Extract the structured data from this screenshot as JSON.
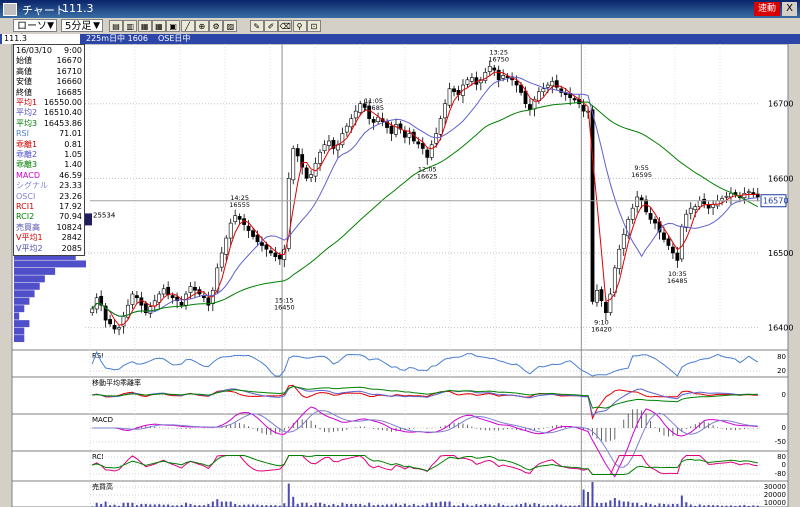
{
  "titlebar": {
    "title": "チャート",
    "code": "111.3",
    "live_label": "速動",
    "close_label": "X"
  },
  "toolbar": {
    "chart_type": "ローソク",
    "interval": "5分足",
    "arrow": "▼",
    "tool_icons": [
      "chart-type-icon",
      "bar-chart-icon",
      "grid-icon",
      "grid2-icon",
      "period-icon",
      "line-tool-icon",
      "zoom-icon",
      "settings-icon",
      "multi-chart-icon",
      "pen-icon",
      "pencil-icon",
      "erase-icon",
      "search-icon",
      "lock-icon"
    ]
  },
  "infobar": {
    "code": "111.3",
    "item1": "225m日中 1606",
    "item2": "OSE日中"
  },
  "panel": {
    "rows": [
      {
        "label": "16/03/10",
        "value": "9:00",
        "color": "#000000"
      },
      {
        "label": "始値",
        "value": "16670",
        "color": "#000000"
      },
      {
        "label": "高値",
        "value": "16710",
        "color": "#000000"
      },
      {
        "label": "安値",
        "value": "16660",
        "color": "#000000"
      },
      {
        "label": "終値",
        "value": "16685",
        "color": "#000000"
      },
      {
        "label": "平均1",
        "value": "16550.00",
        "color": "#d00000"
      },
      {
        "label": "平均2",
        "value": "16510.40",
        "color": "#5050d0"
      },
      {
        "label": "平均3",
        "value": "16453.86",
        "color": "#008000"
      },
      {
        "label": "RSI",
        "value": "71.01",
        "color": "#4a7fd0"
      },
      {
        "label": "乖離1",
        "value": "0.81",
        "color": "#d00000"
      },
      {
        "label": "乖離2",
        "value": "1.05",
        "color": "#5050d0"
      },
      {
        "label": "乖離3",
        "value": "1.40",
        "color": "#008000"
      },
      {
        "label": "MACD",
        "value": "46.59",
        "color": "#d000d0"
      },
      {
        "label": "シグナル",
        "value": "23.33",
        "color": "#8080d0"
      },
      {
        "label": "OSCI",
        "value": "23.26",
        "color": "#8080d0"
      },
      {
        "label": "RCI1",
        "value": "17.92",
        "color": "#d00000"
      },
      {
        "label": "RCI2",
        "value": "70.94",
        "color": "#008000"
      },
      {
        "label": "売買高",
        "value": "10824",
        "color": "#4a4ab0"
      },
      {
        "label": "V平均1",
        "value": "2842",
        "color": "#d00000"
      },
      {
        "label": "V平均2",
        "value": "2085",
        "color": "#4a4ab0"
      }
    ]
  },
  "colors": {
    "up": "#ffffff",
    "down": "#000000",
    "ma1": "#e00000",
    "ma2": "#6060d0",
    "ma3": "#008000",
    "rsi": "#4a7fd0",
    "macd": "#d000d0",
    "signal": "#8080d0",
    "rci1": "#e00080",
    "rci2": "#008000",
    "volume": "#4a4ab0",
    "grid": "#c0c0c0",
    "price_marker": "#1e3ca0",
    "volume_profile": "#3030c0"
  },
  "chart_data": {
    "type": "candlestick",
    "price_axis": {
      "ticks": [
        16400,
        16500,
        16600,
        16700
      ],
      "range": [
        16370,
        16780
      ]
    },
    "current_price": 16570,
    "volume_profile": {
      "price_min": 16380,
      "price_step": 10,
      "levels": [
        2,
        2,
        3,
        1,
        2,
        3,
        4,
        5,
        6,
        8,
        14,
        12,
        10,
        9,
        8,
        10,
        12,
        9,
        7,
        5,
        6,
        5,
        4,
        3,
        3,
        2,
        2,
        1,
        1,
        2,
        2,
        1,
        3,
        3,
        2,
        2,
        1,
        1,
        1,
        1
      ]
    },
    "peak_label": {
      "value": "25534",
      "price": 16545
    },
    "annotations": [
      {
        "time": "14:25",
        "price": 16555,
        "index": 33,
        "pos": "above"
      },
      {
        "time": "15:15",
        "price": 16450,
        "index": 43,
        "pos": "below"
      },
      {
        "time": "11:05",
        "price": 16685,
        "index": 63,
        "pos": "above"
      },
      {
        "time": "12:05",
        "price": 16625,
        "index": 75,
        "pos": "below"
      },
      {
        "time": "13:25",
        "price": 16750,
        "index": 91,
        "pos": "above"
      },
      {
        "time": "9:10",
        "price": 16420,
        "index": 114,
        "pos": "below"
      },
      {
        "time": "9:55",
        "price": 16595,
        "index": 123,
        "pos": "above"
      },
      {
        "time": "10:35",
        "price": 16485,
        "index": 131,
        "pos": "below"
      }
    ],
    "session_breaks": [
      43,
      110
    ],
    "close": [
      16425,
      16440,
      16430,
      16410,
      16405,
      16398,
      16400,
      16415,
      16430,
      16445,
      16440,
      16430,
      16420,
      16428,
      16436,
      16445,
      16452,
      16444,
      16440,
      16436,
      16430,
      16445,
      16455,
      16450,
      16445,
      16440,
      16430,
      16450,
      16480,
      16500,
      16520,
      16540,
      16550,
      16545,
      16538,
      16530,
      16522,
      16515,
      16510,
      16505,
      16500,
      16495,
      16492,
      16505,
      16600,
      16640,
      16630,
      16615,
      16600,
      16605,
      16620,
      16635,
      16645,
      16650,
      16640,
      16645,
      16660,
      16670,
      16680,
      16690,
      16700,
      16695,
      16680,
      16675,
      16682,
      16676,
      16668,
      16660,
      16672,
      16666,
      16655,
      16660,
      16650,
      16646,
      16640,
      16628,
      16645,
      16660,
      16680,
      16700,
      16720,
      16716,
      16712,
      16725,
      16732,
      16735,
      16726,
      16732,
      16742,
      16750,
      16745,
      16732,
      16738,
      16735,
      16732,
      16725,
      16715,
      16700,
      16692,
      16706,
      16716,
      16720,
      16725,
      16730,
      16722,
      16715,
      16712,
      16708,
      16705,
      16700,
      16690,
      16690,
      16435,
      16450,
      16436,
      16420,
      16445,
      16480,
      16505,
      16525,
      16545,
      16560,
      16575,
      16570,
      16555,
      16545,
      16540,
      16528,
      16518,
      16510,
      16500,
      16490,
      16535,
      16552,
      16560,
      16562,
      16570,
      16566,
      16560,
      16565,
      16570,
      16573,
      16576,
      16580,
      16578,
      16574,
      16580,
      16582,
      16578,
      16575
    ]
  },
  "subcharts": [
    {
      "label": "RSI",
      "ticks": [
        "80",
        "20"
      ]
    },
    {
      "label": "移動平均乖離率",
      "ticks": [
        "0"
      ]
    },
    {
      "label": "MACD",
      "ticks": [
        "0",
        "-50"
      ]
    },
    {
      "label": "RCI",
      "ticks": [
        "80",
        "0",
        "-80"
      ]
    },
    {
      "label": "売買高",
      "ticks": [
        "30000",
        "20000",
        "10000"
      ]
    }
  ]
}
